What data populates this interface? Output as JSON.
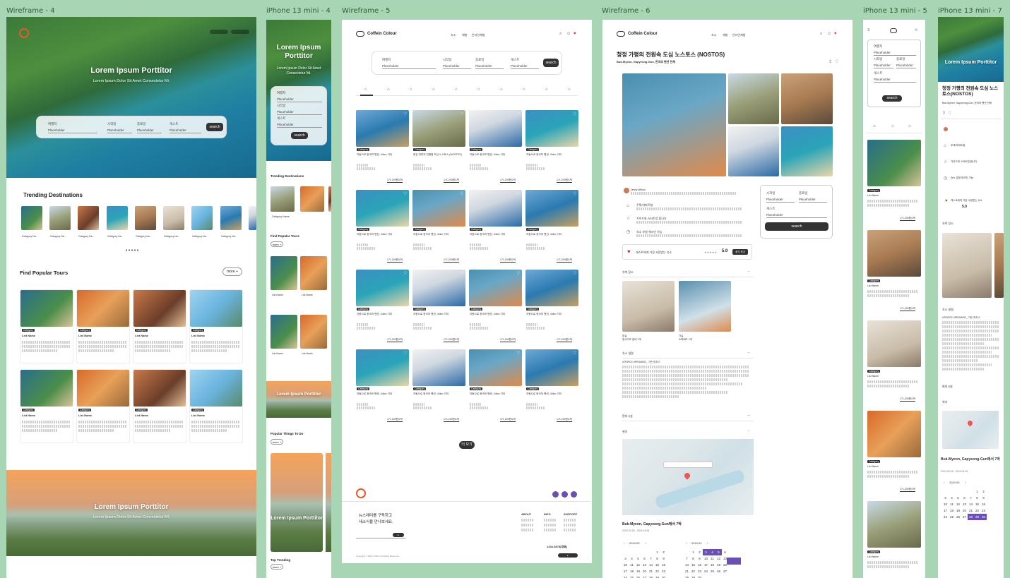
{
  "labels": {
    "w4": "Wireframe - 4",
    "i4": "iPhone 13 mini - 4",
    "w5": "Wireframe - 5",
    "w6": "Wireframe - 6",
    "i5": "iPhone 13 mini - 5",
    "i7": "iPhone 13 mini - 7"
  },
  "hero": {
    "title": "Lorem Ipsum Porttitor",
    "subtitle": "Lorem Ipsum Dolor Sit Amet Consectetur Mi.",
    "mob_title": "Lorem Ipsum Porttitor",
    "mob_sub": "Lorem Ipsum Dolor Sit Amet Consectetur Mi."
  },
  "search": {
    "f1": "여행지",
    "f2": "시작일",
    "f3": "종료일",
    "f4": "게스트",
    "placeholder": "Placeholder",
    "btn": "search"
  },
  "trending": {
    "title": "Trending Destinations",
    "item": "Category Na...",
    "badge": "Tag"
  },
  "popular": {
    "title": "Find Popular Tours",
    "more": "more",
    "category": "Category",
    "list_name": "List Name"
  },
  "banner": {
    "title": "Lorem Ipsum Porttitor",
    "sub": "Lorem Ipsum Dolor Sit Amet Consectetur Mi."
  },
  "mobile4": {
    "trending": "Trending Destinations",
    "item": "Category Name",
    "find": "Find Popular Tours",
    "more": "more",
    "list": "List Name",
    "things": "Popular Things To Do",
    "top": "Top Trending",
    "banner2": "Lorem Ipsum Porttitor"
  },
  "brand": {
    "name": "Coffein Colour"
  },
  "nav": {
    "a": "숙소",
    "b": "체험",
    "c": "온라인체험"
  },
  "listing": {
    "category": "Category",
    "title": "자동으로 한국의 펜션, 44km 거리",
    "title2": "한강 대부의 전원형 도심 노스토스 (NOSTOS)",
    "price": "171,200원/1박",
    "more_btn": "더 보기"
  },
  "footer": {
    "news1": "뉴스레터를 구독하고",
    "news2": "새소식을 만나보세요.",
    "about": "ABOUT",
    "info": "INFO",
    "support": "SUPPORT",
    "phone": "1234-5678(대표)",
    "copyright": "Copyright © 2024 Coffein All Rights Reserved."
  },
  "detail": {
    "title": "청정 가평의 전원속 도심 노스토스 (NOSTOS)",
    "location": "Buk-Myeon, Gapyeong-Gun, 한국의 펜션 전체",
    "host": "Jenny Wilson",
    "feat1": "주택/아파트형",
    "feat2": "가이드와 스타트업 합니다",
    "feat3": "숙소 유형 체크인 가능",
    "fav": "게스트에게 가장 사랑받는 숙소",
    "rating": "5.0",
    "reviews": "후기 보기",
    "sec_room": "숙박 장소",
    "room1": "침실",
    "room1d": "킹사이즈 침대 1개",
    "room2": "거실",
    "room2d": "소파베드 1개",
    "sec_desc": "숙소 설명",
    "desc_tag": "#TRIPCE #PROMISE_ 가든 하우스",
    "sec_amen": "편의시설",
    "sec_loc": "위치",
    "loc_title": "Buk-Myeon, Gapyeong-Gun에서 7박",
    "dates": "2024.03.28 - 2024.04.05",
    "month1": "2024.03",
    "month2": "2024.04",
    "search": "search"
  },
  "i7": {
    "title": "청정 가평의 전원속 도심 노스토스(NOSTOS)",
    "loc": "Buk-Myeon, Gapyeong-Gun, 한국의 펜션 전체",
    "loc_title": "Buk-Myeon, Gapyeong-Gun에서 7박",
    "dates": "2024.03.28 - 2024.04.05",
    "month": "2024.03",
    "rating": "5.0"
  },
  "colors": {
    "accent": "#6a4fb5",
    "bg": "#a8d5b4",
    "dark": "#333333"
  }
}
